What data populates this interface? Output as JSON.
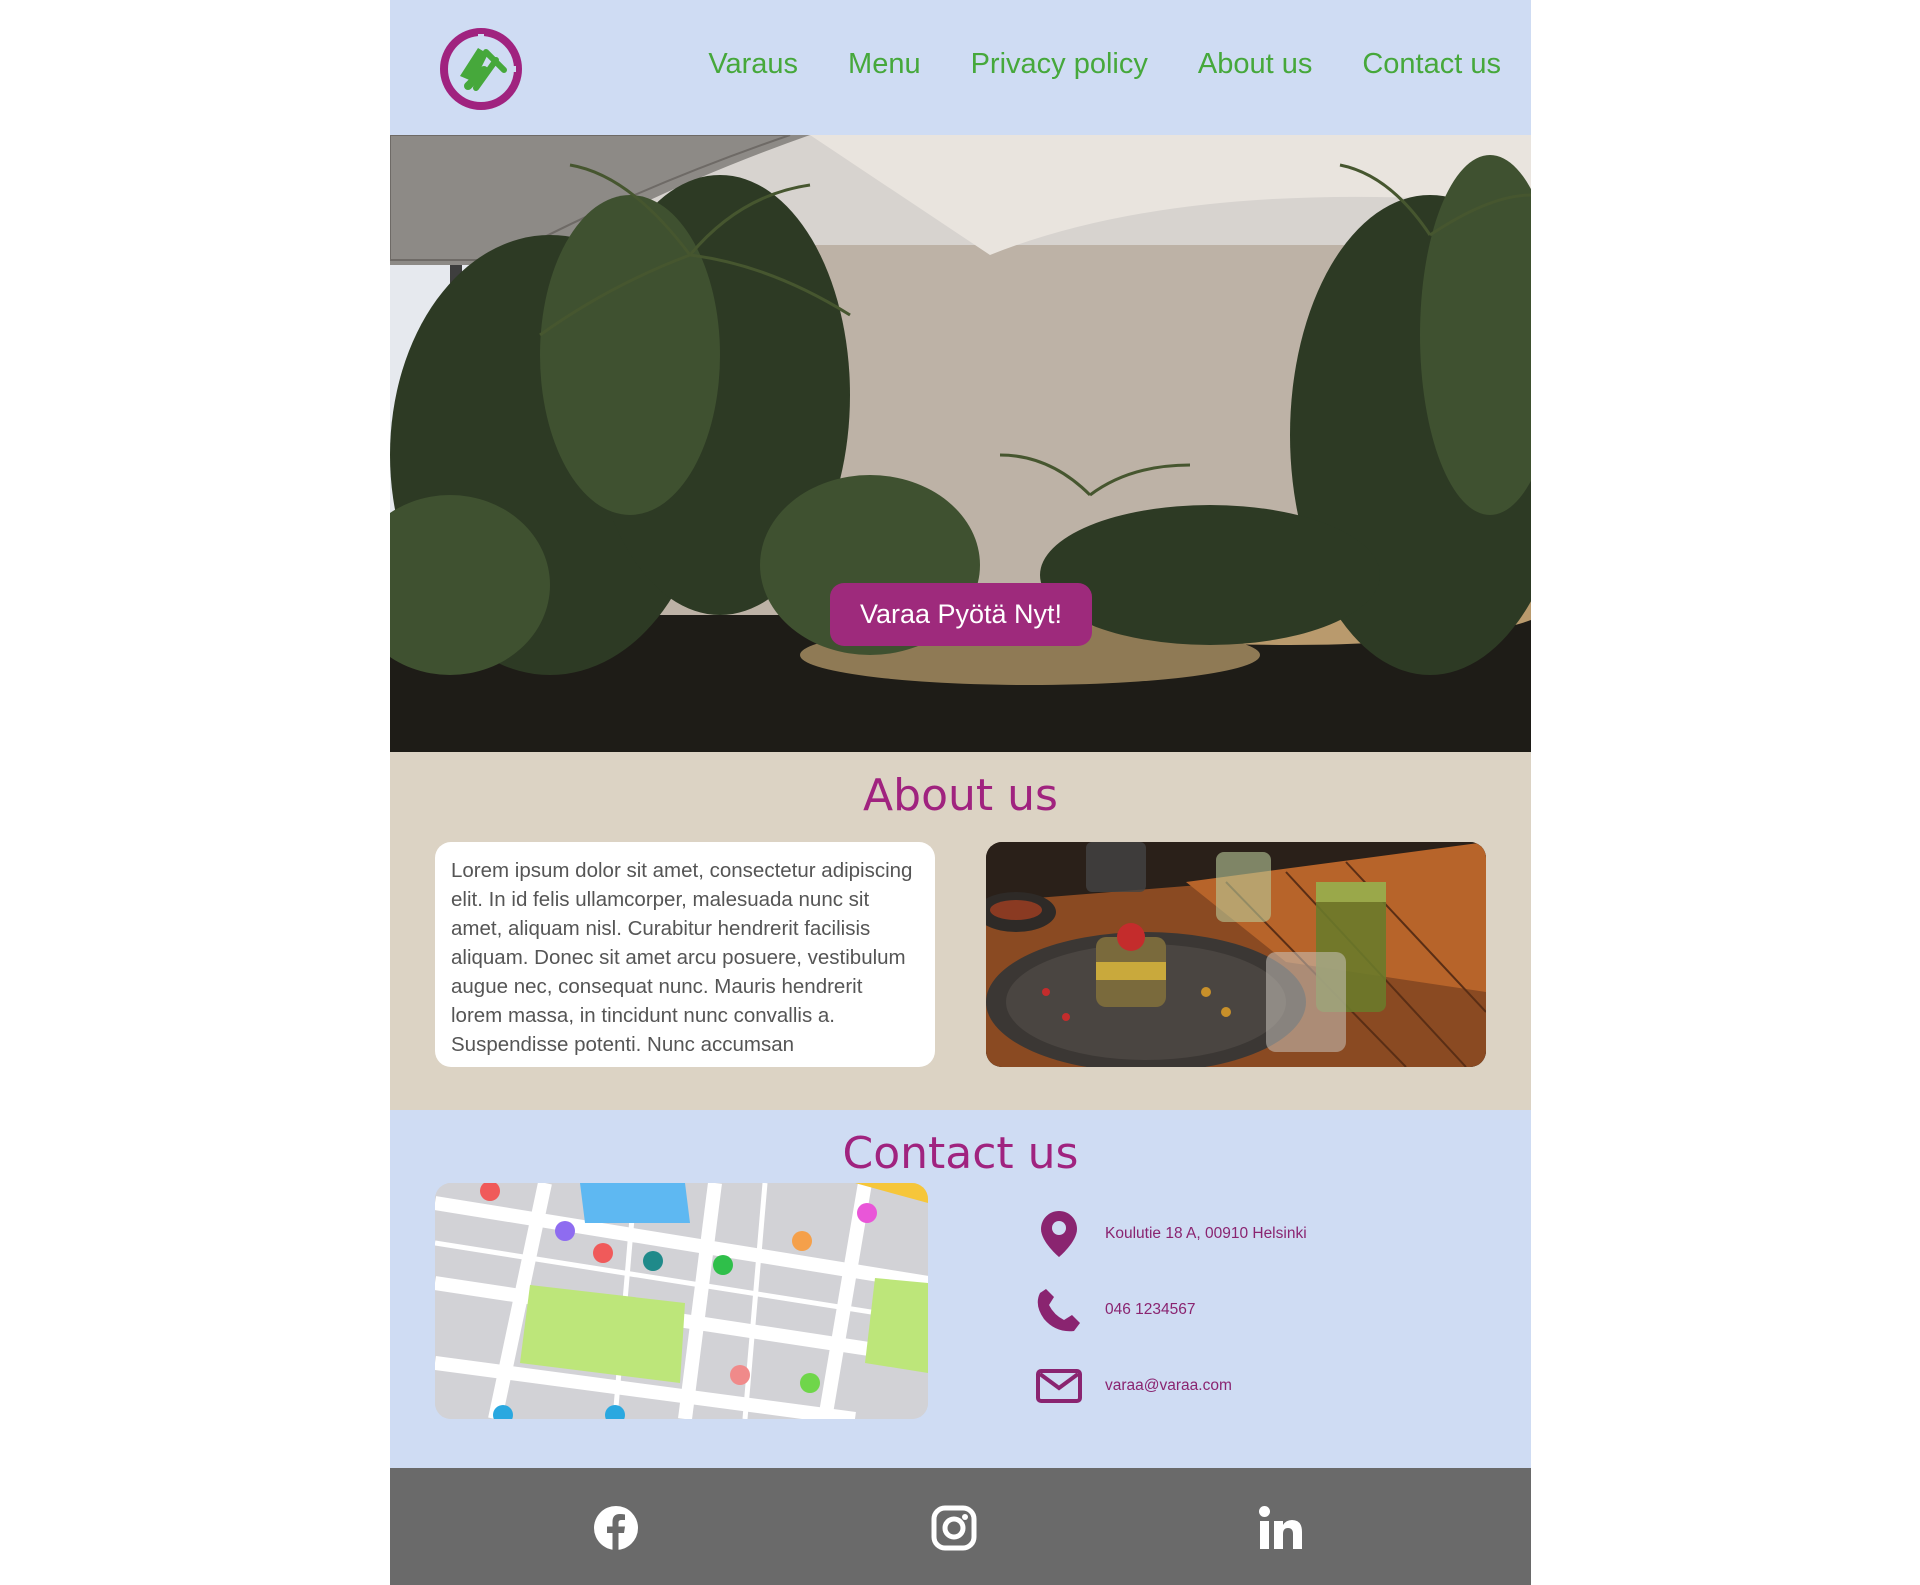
{
  "header": {
    "nav": [
      "Varaus",
      "Menu",
      "Privacy policy",
      "About us",
      "Contact us"
    ]
  },
  "hero": {
    "cta_label": "Varaa Pyötä Nyt!"
  },
  "about": {
    "title": "About us",
    "text": "Lorem ipsum dolor sit amet, consectetur adipiscing elit. In id felis ullamcorper, malesuada nunc sit amet, aliquam nisl. Curabitur hendrerit facilisis aliquam. Donec sit amet arcu posuere, vestibulum augue nec, consequat nunc. Mauris hendrerit lorem massa, in tincidunt nunc convallis a. Suspendisse potenti. Nunc accumsan"
  },
  "contact": {
    "title": "Contact us",
    "address": "Koulutie 18 A, 00910 Helsinki",
    "phone": "046 1234567",
    "email": "varaa@varaa.com",
    "icons": [
      "location-pin-icon",
      "phone-icon",
      "envelope-icon"
    ]
  },
  "footer": {
    "social": [
      "facebook-icon",
      "instagram-icon",
      "linkedin-icon"
    ]
  },
  "colors": {
    "header_bg": "#cfdcf3",
    "nav_text": "#46a83b",
    "accent": "#a0237f",
    "about_bg": "#dcd3c4",
    "footer_bg": "#6a6a6a"
  }
}
